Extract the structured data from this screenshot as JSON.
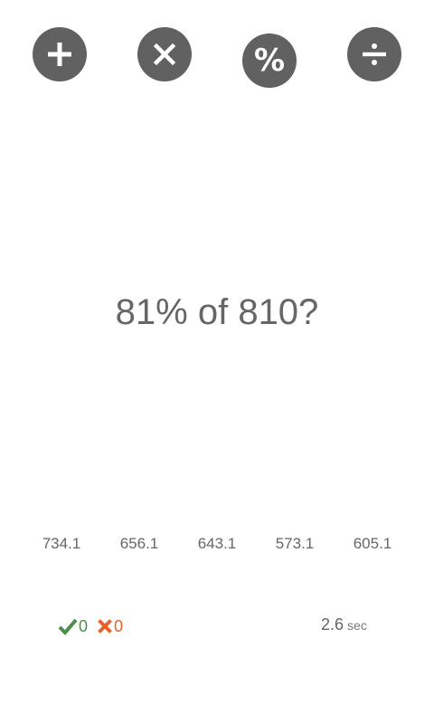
{
  "operations": [
    {
      "id": "plus",
      "icon": "plus-icon"
    },
    {
      "id": "times",
      "icon": "times-icon"
    },
    {
      "id": "percent",
      "icon": "percent-icon",
      "label": "%"
    },
    {
      "id": "divide",
      "icon": "divide-icon"
    }
  ],
  "question": {
    "text": "81% of 810?"
  },
  "answers": [
    "734.1",
    "656.1",
    "643.1",
    "573.1",
    "605.1"
  ],
  "score": {
    "correct": "0",
    "wrong": "0"
  },
  "timer": {
    "value": "2.6",
    "unit": "sec"
  },
  "colors": {
    "button_bg": "#616161",
    "text": "#666666",
    "correct": "#4a8f4a",
    "wrong": "#e8622a"
  }
}
